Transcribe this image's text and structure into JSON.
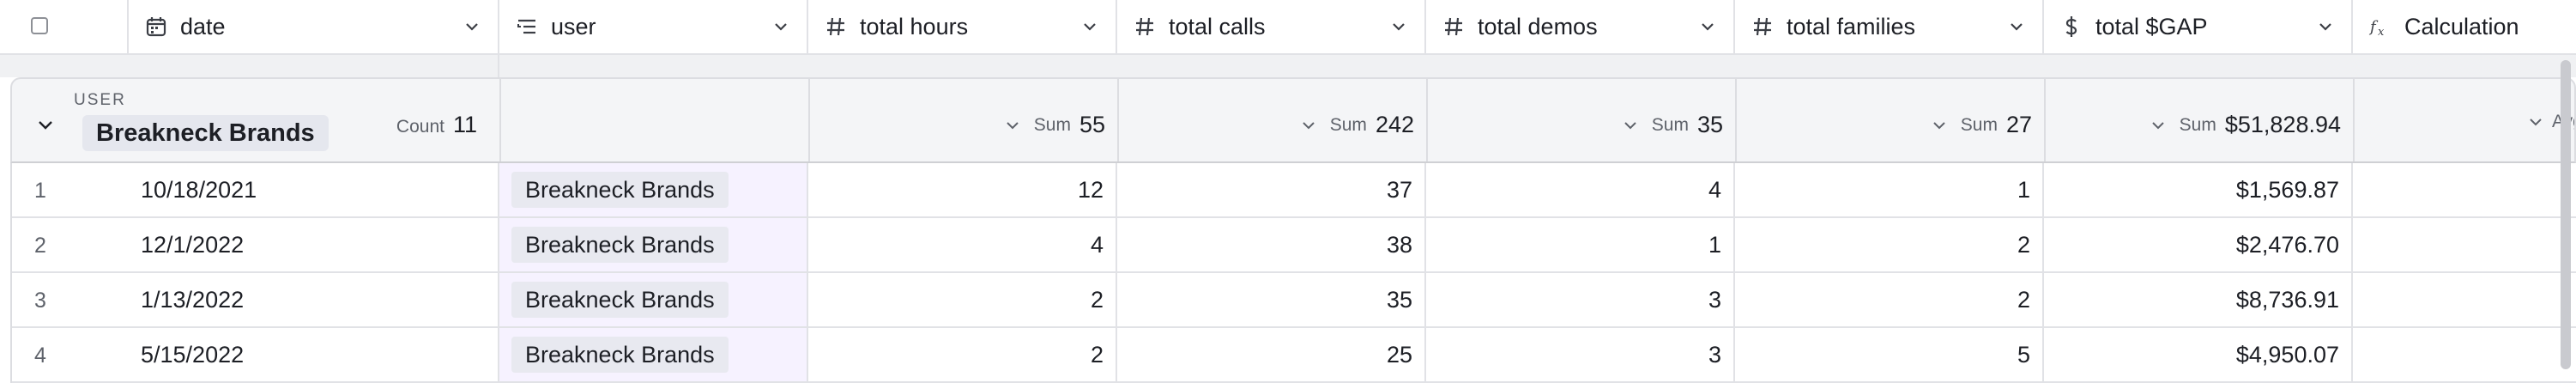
{
  "columns": [
    {
      "label": "date",
      "icon": "calendar-icon"
    },
    {
      "label": "user",
      "icon": "lookup-list-icon"
    },
    {
      "label": "total hours",
      "icon": "number-hash-icon"
    },
    {
      "label": "total calls",
      "icon": "number-hash-icon"
    },
    {
      "label": "total demos",
      "icon": "number-hash-icon"
    },
    {
      "label": "total families",
      "icon": "number-hash-icon"
    },
    {
      "label": "total $GAP",
      "icon": "currency-dollar-icon"
    },
    {
      "label": "Calculation",
      "icon": "formula-fx-icon"
    }
  ],
  "group": {
    "field_label": "USER",
    "name": "Breakneck Brands",
    "count_label": "Count",
    "count": "11",
    "aggregates": [
      {
        "label": "Sum",
        "value": "55"
      },
      {
        "label": "Sum",
        "value": "242"
      },
      {
        "label": "Sum",
        "value": "35"
      },
      {
        "label": "Sum",
        "value": "27"
      },
      {
        "label": "Sum",
        "value": "$51,828.94"
      },
      {
        "label": "Avg",
        "value": ""
      }
    ]
  },
  "rows": [
    {
      "num": "1",
      "date": "10/18/2021",
      "user": "Breakneck Brands",
      "hours": "12",
      "calls": "37",
      "demos": "4",
      "families": "1",
      "gap": "$1,569.87"
    },
    {
      "num": "2",
      "date": "12/1/2022",
      "user": "Breakneck Brands",
      "hours": "4",
      "calls": "38",
      "demos": "1",
      "families": "2",
      "gap": "$2,476.70"
    },
    {
      "num": "3",
      "date": "1/13/2022",
      "user": "Breakneck Brands",
      "hours": "2",
      "calls": "35",
      "demos": "3",
      "families": "2",
      "gap": "$8,736.91"
    },
    {
      "num": "4",
      "date": "5/15/2022",
      "user": "Breakneck Brands",
      "hours": "2",
      "calls": "25",
      "demos": "3",
      "families": "5",
      "gap": "$4,950.07"
    }
  ]
}
